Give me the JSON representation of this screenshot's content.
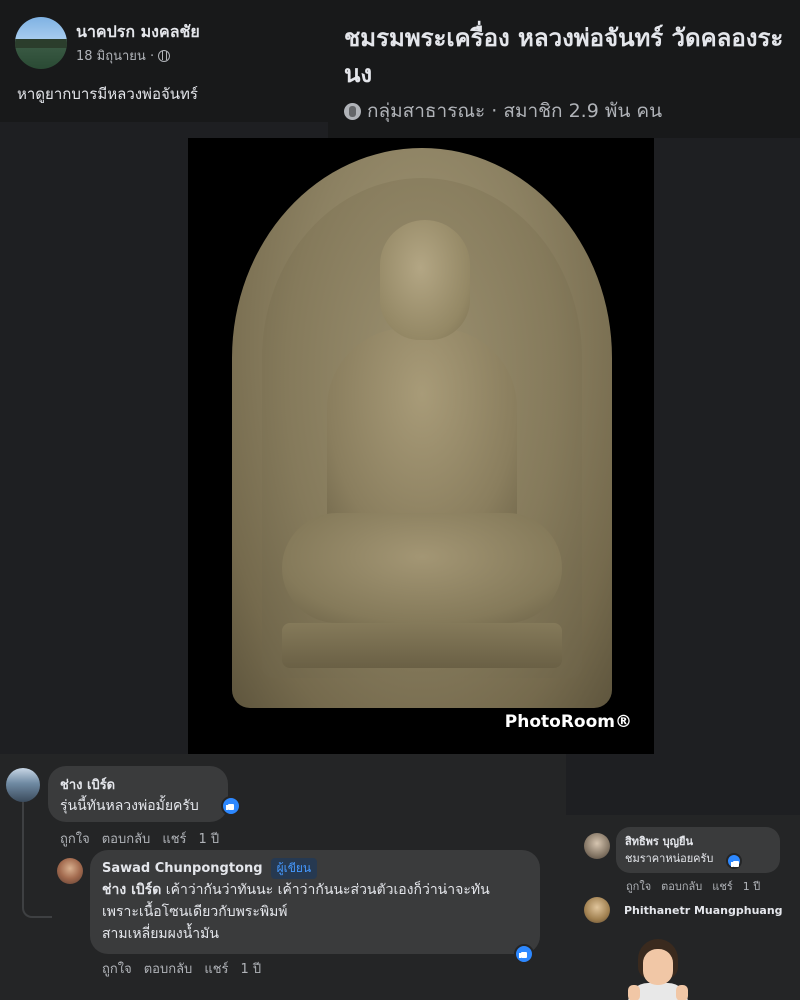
{
  "post": {
    "author": "นาคปรก มงคลชัย",
    "date": "18 มิถุนายน ·",
    "text": "หาดูยากบารมีหลวงพ่อจันทร์"
  },
  "group": {
    "title": "ชมรมพระเครื่อง หลวงพ่อจันทร์ วัดคลองระนง",
    "meta": "กลุ่มสาธารณะ · สมาชิก 2.9 พัน คน"
  },
  "photo": {
    "watermark": "PhotoRoom®"
  },
  "comments": [
    {
      "author": "ช่าง เบิร์ด",
      "text": "รุ่นนี้ทันหลวงพ่อมั้ยครับ",
      "actions": {
        "like": "ถูกใจ",
        "reply": "ตอบกลับ",
        "share": "แชร์",
        "time": "1 ปี"
      }
    },
    {
      "author": "Sawad Chunpongtong",
      "badge": "ผู้เขียน",
      "mention": "ช่าง เบิร์ด",
      "line1": " เค้าว่ากันว่าทันนะ เค้าว่ากันนะส่วนตัวเองก็ว่าน่าจะทัน",
      "line2": "เพราะเนื้อโซนเดียวกับพระพิมพ์",
      "line3": "สามเหลี่ยมผงน้ำมัน",
      "actions": {
        "like": "ถูกใจ",
        "reply": "ตอบกลับ",
        "share": "แชร์",
        "time": "1 ปี"
      }
    }
  ],
  "side_comments": [
    {
      "author": "สิทธิพร บุญยืน",
      "text": "ชมราคาหน่อยครับ",
      "actions": {
        "like": "ถูกใจ",
        "reply": "ตอบกลับ",
        "share": "แชร์",
        "time": "1 ปี"
      }
    },
    {
      "author": "Phithanetr Muangphuang"
    }
  ],
  "colors": {
    "background": "#1e1f22",
    "card": "#242526",
    "bubble": "#3a3b3c",
    "like_blue": "#2d88ff",
    "author_badge": "#4599ff"
  },
  "icons": [
    "globe-icon",
    "like-reaction-icon",
    "avatar",
    "emoji-person-icon"
  ]
}
